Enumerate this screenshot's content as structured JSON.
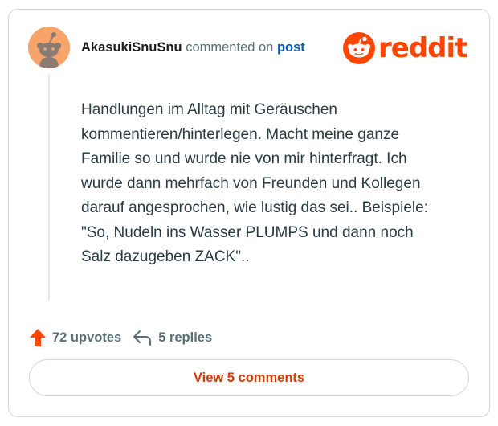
{
  "comment": {
    "username": "AkasukiSnuSnu",
    "commented_on": "commented on",
    "post_link": "post",
    "text": "Handlungen im Alltag mit Geräuschen kommentieren/hinterlegen. Macht meine ganze Familie so und wurde nie von mir hinterfragt. Ich wurde dann mehrfach von Freunden und Kollegen darauf angesprochen, wie lustig das sei.. Beispiele: \"So, Nudeln ins Wasser PLUMPS und dann noch Salz dazugeben ZACK\".."
  },
  "brand": {
    "wordmark": "reddit",
    "color": "#ff4500"
  },
  "stats": {
    "upvotes": "72 upvotes",
    "replies": "5 replies",
    "upvote_icon": "upvote-arrow-icon",
    "reply_icon": "reply-arrow-icon",
    "upvote_color": "#ff4500"
  },
  "actions": {
    "view_comments": "View 5 comments"
  },
  "avatar": {
    "icon": "snoo-avatar-icon",
    "color": "#f7a46b"
  }
}
